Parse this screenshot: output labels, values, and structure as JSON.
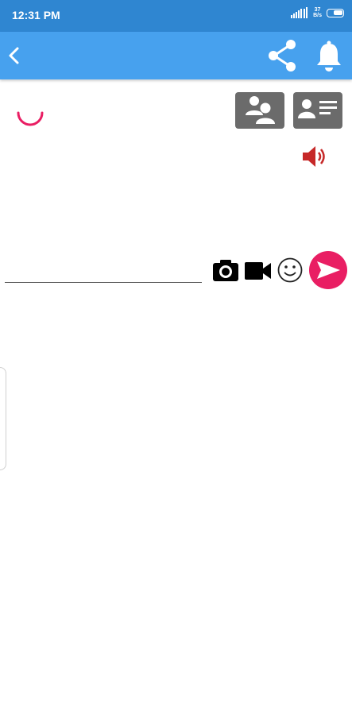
{
  "status_bar": {
    "time": "12:31 PM",
    "net_speed_value": "37",
    "net_speed_unit": "B/s",
    "icons": [
      "signal-icon",
      "wifi-icon",
      "battery-icon"
    ]
  },
  "app_bar": {
    "color": "#47a1ee",
    "icons": [
      "chevron-left-icon",
      "share-icon",
      "bell-icon"
    ]
  },
  "chat": {
    "input_value": "",
    "input_placeholder": "",
    "icons": [
      "group-icon",
      "profile-card-icon",
      "speaker-icon",
      "camera-icon",
      "video-camera-icon",
      "smiley-icon",
      "send-icon"
    ]
  },
  "colors": {
    "accent": "#e91e63",
    "speaker": "#c62828",
    "action_button": "#6b6b6b"
  }
}
